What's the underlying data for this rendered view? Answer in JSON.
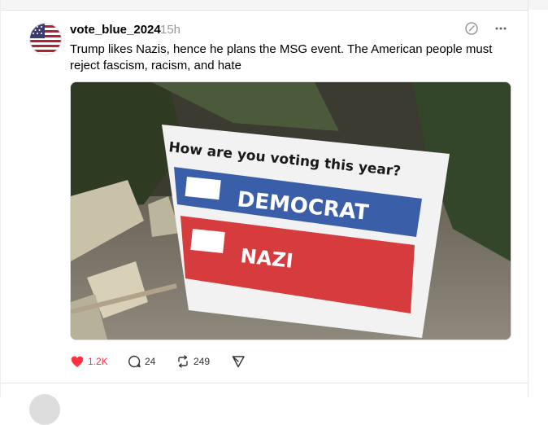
{
  "post": {
    "username": "vote_blue_2024",
    "timestamp": "15h",
    "text": "Trump likes Nazis, hence he plans the MSG event. The American people must reject fascism, racism, and hate",
    "image": {
      "sign_question": "How are you voting this year?",
      "option_1": "DEMOCRAT",
      "option_2": "NAZI"
    },
    "actions": {
      "likes": "1.2K",
      "replies": "24",
      "reposts": "249"
    }
  },
  "colors": {
    "like_red": "#ff3040",
    "sign_blue": "#3a5fa8",
    "sign_red": "#d63c3e"
  },
  "icons": [
    "edit-icon",
    "more-icon",
    "heart-icon",
    "comment-icon",
    "repost-icon",
    "share-icon"
  ]
}
